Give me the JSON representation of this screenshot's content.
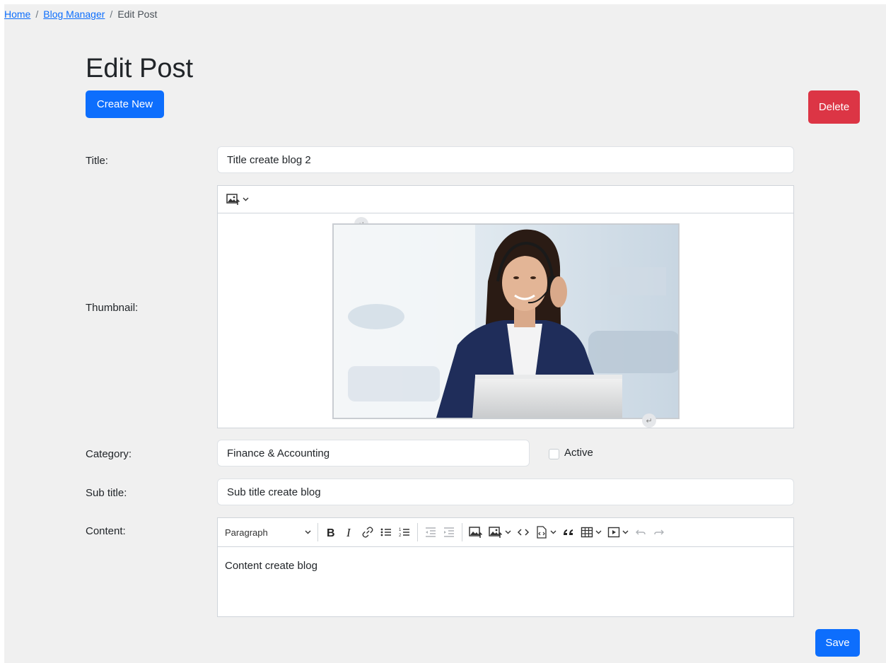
{
  "breadcrumb": {
    "home": "Home",
    "sep1": "/",
    "blog_manager": "Blog Manager",
    "sep2": "/",
    "current": "Edit Post"
  },
  "page_title": "Edit Post",
  "buttons": {
    "create_new": "Create New",
    "delete": "Delete",
    "save": "Save"
  },
  "form": {
    "title_label": "Title:",
    "title_value": "Title create blog 2",
    "thumbnail_label": "Thumbnail:",
    "category_label": "Category:",
    "category_value": "Finance & Accounting",
    "active_label": "Active",
    "active_checked": false,
    "subtitle_label": "Sub title:",
    "subtitle_value": "Sub title create blog",
    "content_label": "Content:",
    "content_value": "Content create blog"
  },
  "content_toolbar": {
    "heading_select": "Paragraph",
    "tools": [
      "bold-icon",
      "italic-icon",
      "link-icon",
      "bulleted-list-icon",
      "numbered-list-icon",
      "outdent-icon",
      "indent-icon",
      "image-upload-icon",
      "insert-image-icon",
      "code-icon",
      "source-editing-icon",
      "block-quote-icon",
      "table-icon",
      "media-embed-icon",
      "undo-icon",
      "redo-icon"
    ]
  },
  "colors": {
    "primary": "#0d6efd",
    "danger": "#dc3545",
    "page_bg": "#f0f0f0"
  }
}
